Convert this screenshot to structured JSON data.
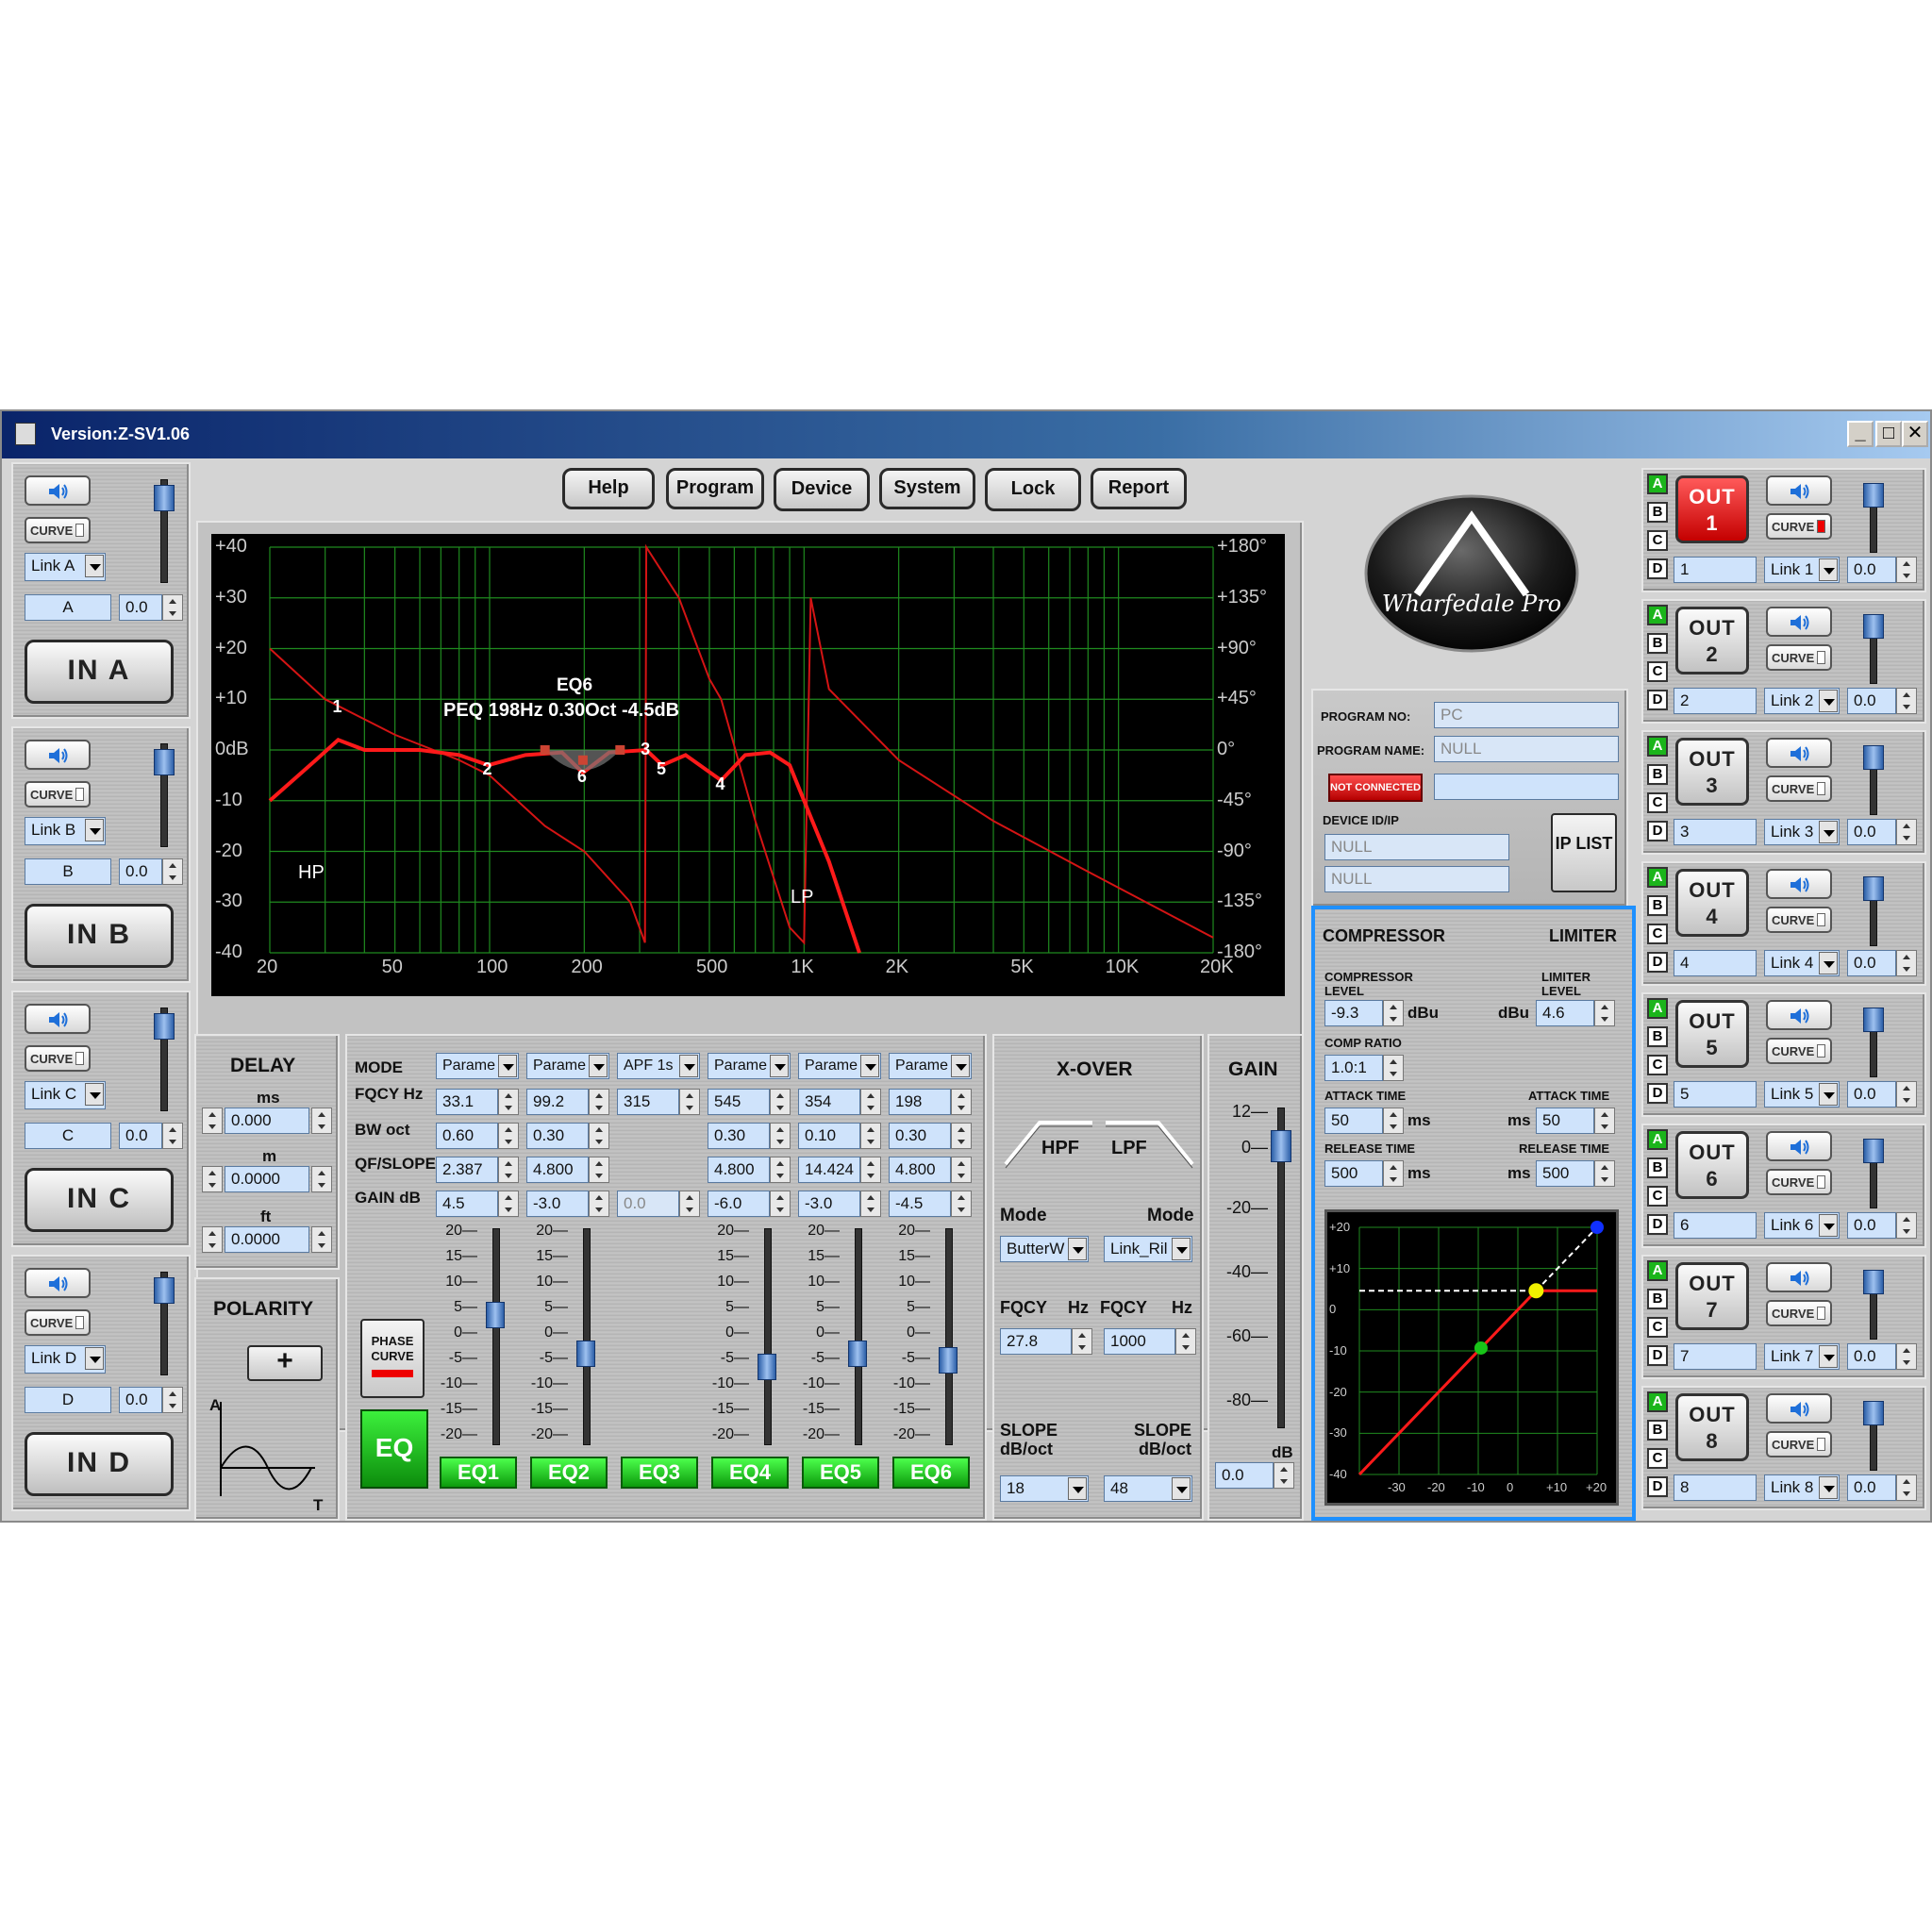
{
  "window": {
    "title": "Version:Z-SV1.06",
    "controls": [
      "_",
      "□",
      "✕"
    ]
  },
  "toolbar": {
    "help": "Help",
    "program": "Program",
    "device": "Device",
    "system": "System",
    "lock": "Lock",
    "report": "Report"
  },
  "inputs": [
    {
      "curve": "CURVE",
      "link": "Link A",
      "name": "A",
      "gain": "0.0",
      "button": "IN A"
    },
    {
      "curve": "CURVE",
      "link": "Link B",
      "name": "B",
      "gain": "0.0",
      "button": "IN B"
    },
    {
      "curve": "CURVE",
      "link": "Link C",
      "name": "C",
      "gain": "0.0",
      "button": "IN C"
    },
    {
      "curve": "CURVE",
      "link": "Link D",
      "name": "D",
      "gain": "0.0",
      "button": "IN D"
    }
  ],
  "graph": {
    "left_ticks": [
      "+40",
      "+30",
      "+20",
      "+10",
      "0dB",
      "-10",
      "-20",
      "-30",
      "-40"
    ],
    "right_ticks": [
      "+180°",
      "+135°",
      "+90°",
      "+45°",
      "0°",
      "-45°",
      "-90°",
      "-135°",
      "-180°"
    ],
    "freq_ticks": [
      "20",
      "50",
      "100",
      "200",
      "500",
      "1K",
      "2K",
      "5K",
      "10K",
      "20K"
    ],
    "eq_label": "EQ6",
    "info": "PEQ  198Hz 0.30Oct -4.5dB",
    "markers": [
      "1",
      "2",
      "6",
      "3",
      "5",
      "4"
    ],
    "hp": "HP",
    "lp": "LP"
  },
  "delay": {
    "title": "DELAY",
    "ms_label": "ms",
    "ms": "0.000",
    "m_label": "m",
    "m": "0.0000",
    "ft_label": "ft",
    "ft": "0.0000"
  },
  "polarity": {
    "title": "POLARITY",
    "sign": "+",
    "axis_a": "A",
    "axis_t": "T"
  },
  "eq": {
    "labels": {
      "mode": "MODE",
      "fqcy": "FQCY Hz",
      "bw": "BW oct",
      "qf": "QF/SLOPE",
      "gain": "GAIN dB"
    },
    "phase_curve": "PHASE CURVE",
    "eq_button": "EQ",
    "scale": [
      "20—",
      "15—",
      "10—",
      "5—",
      "0—",
      "-5—",
      "-10—",
      "-15—",
      "-20—"
    ],
    "bands": [
      {
        "mode": "Parame",
        "fqcy": "33.1",
        "bw": "0.60",
        "qf": "2.387",
        "gain": "4.5",
        "button": "EQ1",
        "level": 0.4
      },
      {
        "mode": "Parame",
        "fqcy": "99.2",
        "bw": "0.30",
        "qf": "4.800",
        "gain": "-3.0",
        "button": "EQ2",
        "level": 0.58
      },
      {
        "mode": "APF 1s",
        "fqcy": "315",
        "bw": "",
        "qf": "",
        "gain": "0.0",
        "button": "EQ3",
        "level": null
      },
      {
        "mode": "Parame",
        "fqcy": "545",
        "bw": "0.30",
        "qf": "4.800",
        "gain": "-6.0",
        "button": "EQ4",
        "level": 0.64
      },
      {
        "mode": "Parame",
        "fqcy": "354",
        "bw": "0.10",
        "qf": "14.424",
        "gain": "-3.0",
        "button": "EQ5",
        "level": 0.58
      },
      {
        "mode": "Parame",
        "fqcy": "198",
        "bw": "0.30",
        "qf": "4.800",
        "gain": "-4.5",
        "button": "EQ6",
        "level": 0.61
      }
    ]
  },
  "xover": {
    "title": "X-OVER",
    "hpf": "HPF",
    "lpf": "LPF",
    "mode_label": "Mode",
    "hpf_mode": "ButterW",
    "lpf_mode": "Link_Ril",
    "fqcy_label": "FQCY",
    "hz": "Hz",
    "hpf_fqcy": "27.8",
    "lpf_fqcy": "1000",
    "slope_label": "SLOPE",
    "slope_unit": "dB/oct",
    "hpf_slope": "18",
    "lpf_slope": "48"
  },
  "gain": {
    "title": "GAIN",
    "scale": [
      "12—",
      "0—",
      "-20—",
      "-40—",
      "-60—",
      "-80—"
    ],
    "unit": "dB",
    "value": "0.0"
  },
  "program": {
    "no_label": "PROGRAM NO:",
    "no": "PC",
    "name_label": "PROGRAM NAME:",
    "name": "NULL",
    "status": "NOT CONNECTED",
    "device_label": "DEVICE ID/IP",
    "device_id": "NULL",
    "device_ip": "NULL",
    "ip_list": "IP LIST"
  },
  "logo": {
    "text": "Wharfedale Pro"
  },
  "compressor": {
    "title": "COMPRESSOR",
    "limiter_title": "LIMITER",
    "comp_level_label": "COMPRESSOR LEVEL",
    "comp_level": "-9.3",
    "dbu": "dBu",
    "limiter_level_label": "LIMITER LEVEL",
    "limiter_level": "4.6",
    "ratio_label": "COMP RATIO",
    "ratio": "1.0:1",
    "attack_label": "ATTACK TIME",
    "attack": "50",
    "ms": "ms",
    "limit_attack": "50",
    "release_label": "RELEASE TIME",
    "release": "500",
    "limit_release": "500",
    "chart_y": [
      "+20",
      "+10",
      "0",
      "-10",
      "-20",
      "-30",
      "-40"
    ],
    "chart_x": [
      "-30",
      "-20",
      "-10",
      "0",
      "+10",
      "+20"
    ]
  },
  "outputs": [
    {
      "label": "OUT",
      "num": "1",
      "name": "1",
      "link": "Link 1",
      "gain": "0.0",
      "active": true
    },
    {
      "label": "OUT",
      "num": "2",
      "name": "2",
      "link": "Link 2",
      "gain": "0.0",
      "active": false
    },
    {
      "label": "OUT",
      "num": "3",
      "name": "3",
      "link": "Link 3",
      "gain": "0.0",
      "active": false
    },
    {
      "label": "OUT",
      "num": "4",
      "name": "4",
      "link": "Link 4",
      "gain": "0.0",
      "active": false
    },
    {
      "label": "OUT",
      "num": "5",
      "name": "5",
      "link": "Link 5",
      "gain": "0.0",
      "active": false
    },
    {
      "label": "OUT",
      "num": "6",
      "name": "6",
      "link": "Link 6",
      "gain": "0.0",
      "active": false
    },
    {
      "label": "OUT",
      "num": "7",
      "name": "7",
      "link": "Link 7",
      "gain": "0.0",
      "active": false
    },
    {
      "label": "OUT",
      "num": "8",
      "name": "8",
      "link": "Link 8",
      "gain": "0.0",
      "active": false
    }
  ],
  "abcd": [
    "A",
    "B",
    "C",
    "D"
  ],
  "colors": {
    "curve": "#ff1a1a",
    "grid": "#1f8a1f",
    "eq_green": "#18c418",
    "out_active": "#e01010",
    "accent_blue": "#1e90ff"
  }
}
